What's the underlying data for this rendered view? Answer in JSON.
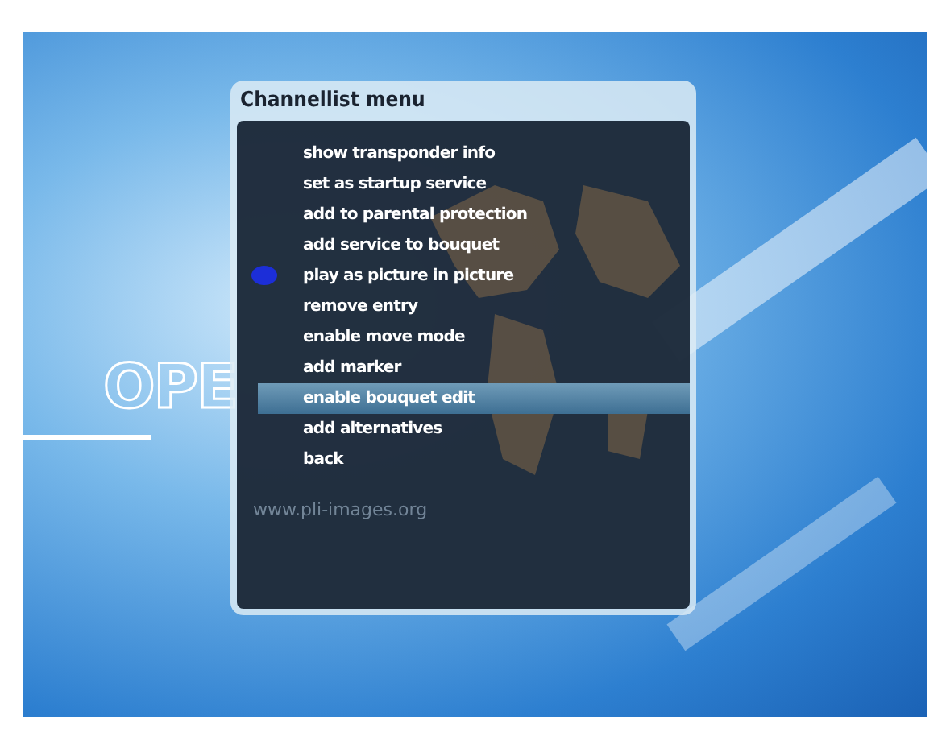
{
  "background": {
    "logo": "OPE",
    "url": "www.pli-images.org"
  },
  "window": {
    "title": "Channellist menu"
  },
  "menu": {
    "items": [
      {
        "label": "show transponder info",
        "selected": false
      },
      {
        "label": "set as startup service",
        "selected": false
      },
      {
        "label": "add to parental protection",
        "selected": false
      },
      {
        "label": "add service to bouquet",
        "selected": false
      },
      {
        "label": "play as picture in picture",
        "selected": false,
        "color": "#1c2ed8"
      },
      {
        "label": "remove entry",
        "selected": false
      },
      {
        "label": "enable move mode",
        "selected": false
      },
      {
        "label": "add marker",
        "selected": false
      },
      {
        "label": "enable bouquet edit",
        "selected": true
      },
      {
        "label": "add alternatives",
        "selected": false
      },
      {
        "label": "back",
        "selected": false
      }
    ]
  }
}
